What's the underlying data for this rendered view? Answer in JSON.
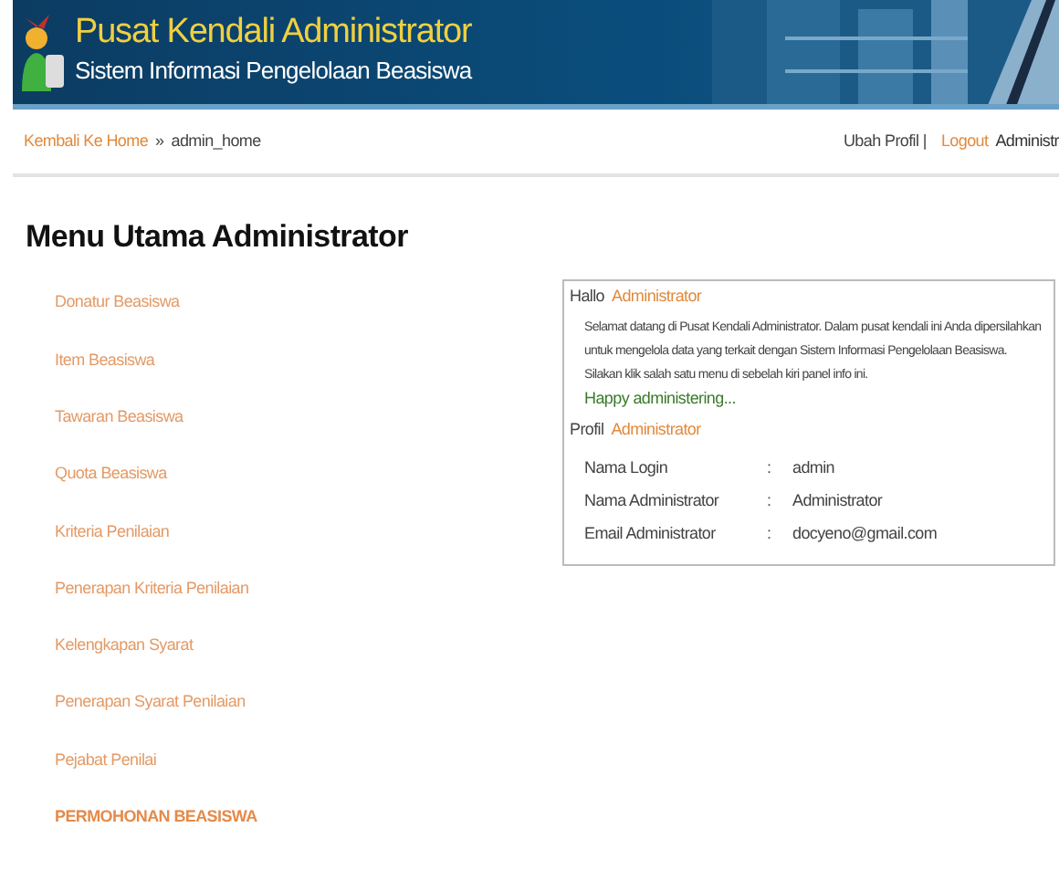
{
  "header": {
    "title": "Pusat Kendali Administrator",
    "subtitle": "Sistem Informasi Pengelolaan Beasiswa"
  },
  "breadcrumb": {
    "link": "Kembali Ke Home",
    "separator": "»",
    "current": "admin_home"
  },
  "user_menu": {
    "profile": "Ubah Profil |",
    "logout": "Logout",
    "user": "Administr"
  },
  "page_title": "Menu Utama Administrator",
  "menu": [
    {
      "label": "Donatur Beasiswa",
      "kind": "link"
    },
    {
      "label": "Item Beasiswa",
      "kind": "link"
    },
    {
      "label": "Tawaran Beasiswa",
      "kind": "link"
    },
    {
      "label": "Quota Beasiswa",
      "kind": "link"
    },
    {
      "label": "Kriteria Penilaian",
      "kind": "link"
    },
    {
      "label": "Penerapan Kriteria Penilaian",
      "kind": "link"
    },
    {
      "label": "Kelengkapan Syarat",
      "kind": "link"
    },
    {
      "label": "Penerapan Syarat Penilaian",
      "kind": "link"
    },
    {
      "label": "Pejabat Penilai",
      "kind": "link"
    },
    {
      "label": "PERMOHONAN BEASISWA",
      "kind": "strong"
    }
  ],
  "info_panel": {
    "greeting": "Hallo",
    "greeting_name": "Administrator",
    "lines": [
      "Selamat datang di Pusat Kendali Administrator. Dalam pusat kendali ini Anda dipersilahkan",
      "untuk mengelola data yang terkait dengan Sistem Informasi Pengelolaan Beasiswa.",
      "Silakan klik salah satu menu di sebelah kiri panel info ini."
    ],
    "closing": "Happy administering...",
    "profile_label": "Profil",
    "profile_name": "Administrator",
    "fields": [
      {
        "label": "Nama Login",
        "separator": ":",
        "value": "admin"
      },
      {
        "label": "Nama Administrator",
        "separator": ":",
        "value": "Administrator"
      },
      {
        "label": "Email Administrator",
        "separator": ":",
        "value": "docyeno@gmail.com"
      }
    ]
  }
}
